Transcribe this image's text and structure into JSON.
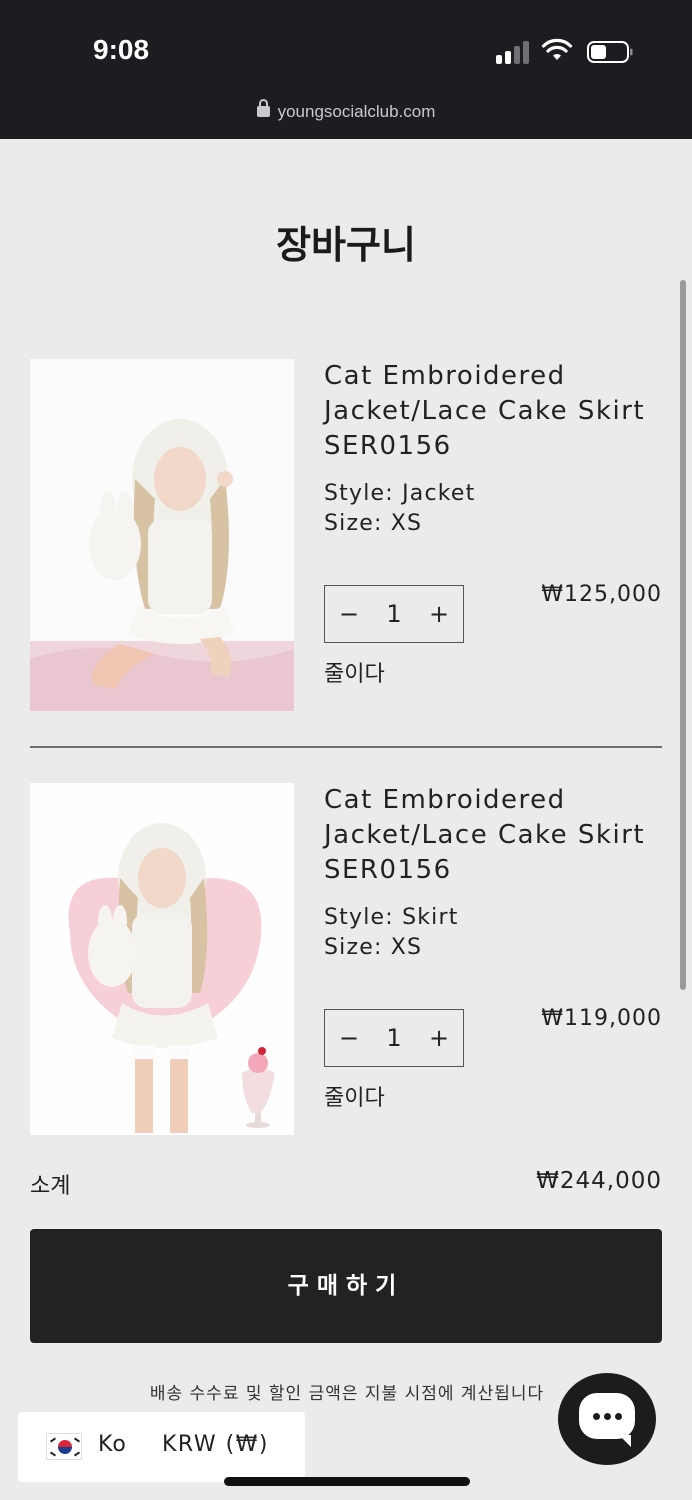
{
  "status_bar": {
    "time": "9:08",
    "url": "youngsocialclub.com"
  },
  "page": {
    "title": "장바구니"
  },
  "cart": {
    "items": [
      {
        "name": "Cat Embroidered Jacket/Lace Cake Skirt SER0156",
        "style_label": "Style:",
        "style_value": "Jacket",
        "size_label": "Size:",
        "size_value": "XS",
        "quantity": "1",
        "minus": "−",
        "plus": "+",
        "price": "₩125,000",
        "remove_label": "줄이다",
        "image_icon": "product-photo-jacket"
      },
      {
        "name": "Cat Embroidered Jacket/Lace Cake Skirt SER0156",
        "style_label": "Style:",
        "style_value": "Skirt",
        "size_label": "Size:",
        "size_value": "XS",
        "quantity": "1",
        "minus": "−",
        "plus": "+",
        "price": "₩119,000",
        "remove_label": "줄이다",
        "image_icon": "product-photo-skirt"
      }
    ],
    "subtotal_label": "소계",
    "subtotal_value": "₩244,000",
    "checkout_label": "구매하기",
    "shipping_note": "배송 수수료 및 할인 금액은 지불 시점에 계산됩니다"
  },
  "locale": {
    "language": "Ko",
    "currency": "KRW (₩)",
    "flag_icon": "korea-flag-icon"
  },
  "chat": {
    "icon": "chat-bubble-icon"
  },
  "colors": {
    "dark": "#222222",
    "background": "#ebebeb",
    "status_bar": "#1c1d20"
  }
}
